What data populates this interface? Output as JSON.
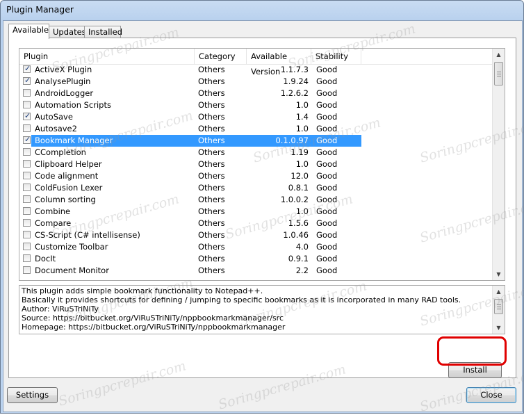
{
  "window": {
    "title": "Plugin Manager"
  },
  "tabs": [
    "Available",
    "Updates",
    "Installed"
  ],
  "columns": {
    "plugin": "Plugin",
    "category": "Category",
    "version": "Available Version",
    "stability": "Stability"
  },
  "plugins": [
    {
      "name": "ActiveX Plugin",
      "category": "Others",
      "version": "1.1.7.3",
      "stability": "Good",
      "checked": true,
      "selected": false
    },
    {
      "name": "AnalysePlugin",
      "category": "Others",
      "version": "1.9.24",
      "stability": "Good",
      "checked": true,
      "selected": false
    },
    {
      "name": "AndroidLogger",
      "category": "Others",
      "version": "1.2.6.2",
      "stability": "Good",
      "checked": false,
      "selected": false
    },
    {
      "name": "Automation Scripts",
      "category": "Others",
      "version": "1.0",
      "stability": "Good",
      "checked": false,
      "selected": false
    },
    {
      "name": "AutoSave",
      "category": "Others",
      "version": "1.4",
      "stability": "Good",
      "checked": true,
      "selected": false
    },
    {
      "name": "Autosave2",
      "category": "Others",
      "version": "1.0",
      "stability": "Good",
      "checked": false,
      "selected": false
    },
    {
      "name": "Bookmark Manager",
      "category": "Others",
      "version": "0.1.0.97",
      "stability": "Good",
      "checked": true,
      "selected": true
    },
    {
      "name": "CCompletion",
      "category": "Others",
      "version": "1.19",
      "stability": "Good",
      "checked": false,
      "selected": false
    },
    {
      "name": "Clipboard Helper",
      "category": "Others",
      "version": "1.0",
      "stability": "Good",
      "checked": false,
      "selected": false
    },
    {
      "name": "Code alignment",
      "category": "Others",
      "version": "12.0",
      "stability": "Good",
      "checked": false,
      "selected": false
    },
    {
      "name": "ColdFusion Lexer",
      "category": "Others",
      "version": "0.8.1",
      "stability": "Good",
      "checked": false,
      "selected": false
    },
    {
      "name": "Column sorting",
      "category": "Others",
      "version": "1.0.0.2",
      "stability": "Good",
      "checked": false,
      "selected": false
    },
    {
      "name": "Combine",
      "category": "Others",
      "version": "1.0",
      "stability": "Good",
      "checked": false,
      "selected": false
    },
    {
      "name": "Compare",
      "category": "Others",
      "version": "1.5.6",
      "stability": "Good",
      "checked": false,
      "selected": false
    },
    {
      "name": "CS-Script (C# intellisense)",
      "category": "Others",
      "version": "1.0.46",
      "stability": "Good",
      "checked": false,
      "selected": false
    },
    {
      "name": "Customize Toolbar",
      "category": "Others",
      "version": "4.0",
      "stability": "Good",
      "checked": false,
      "selected": false
    },
    {
      "name": "DocIt",
      "category": "Others",
      "version": "0.9.1",
      "stability": "Good",
      "checked": false,
      "selected": false
    },
    {
      "name": "Document Monitor",
      "category": "Others",
      "version": "2.2",
      "stability": "Good",
      "checked": false,
      "selected": false
    }
  ],
  "description": [
    "This plugin adds simple bookmark functionality to Notepad++.",
    "Basically it provides shortcuts for defining / jumping to specific bookmarks as it is incorporated in many RAD tools.",
    "Author: ViRuSTriNiTy",
    "Source: https://bitbucket.org/ViRuSTriNiTy/nppbookmarkmanager/src",
    "Homepage: https://bitbucket.org/ViRuSTriNiTy/nppbookmarkmanager"
  ],
  "buttons": {
    "install": "Install",
    "settings": "Settings",
    "close": "Close"
  },
  "watermark": "Soringpcrepair.com",
  "colors": {
    "selection": "#3399ff",
    "annotation": "#e00000"
  },
  "icons": {
    "scroll_up": "chevron-up-icon",
    "scroll_down": "chevron-down-icon",
    "check": "check-icon"
  }
}
